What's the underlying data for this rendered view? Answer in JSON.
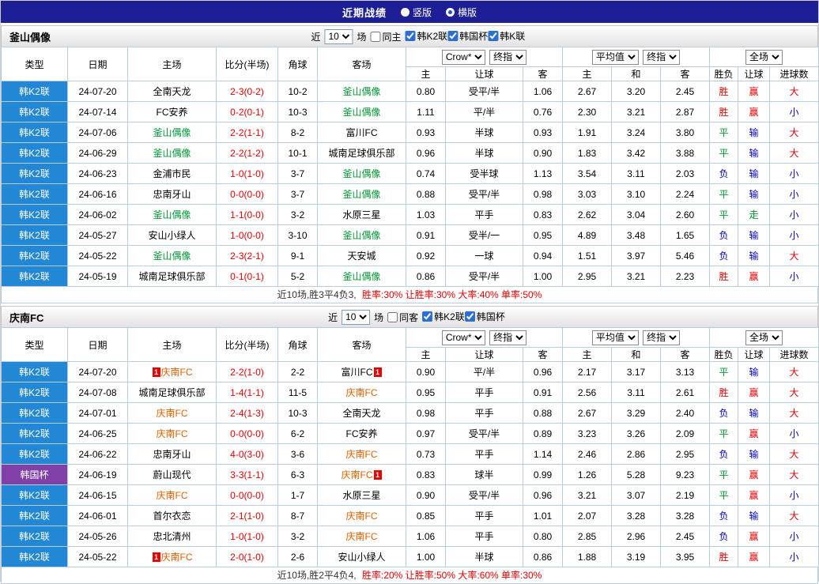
{
  "topbar": {
    "title": "近期战绩",
    "options": [
      {
        "label": "竖版",
        "selected": false
      },
      {
        "label": "横版",
        "selected": true
      }
    ]
  },
  "labels": {
    "near": "近",
    "games": "场",
    "col_type": "类型",
    "col_date": "日期",
    "col_home": "主场",
    "col_score": "比分(半场)",
    "col_corner": "角球",
    "col_away": "客场",
    "crow": "Crow*",
    "final": "终指",
    "average": "平均值",
    "full": "全场",
    "sub_home": "主",
    "sub_handicap": "让球",
    "sub_away": "客",
    "sub_avg_home": "主",
    "sub_avg_draw": "和",
    "sub_avg_away": "客",
    "sub_result": "胜负",
    "sub_handicap2": "让球",
    "sub_goals": "进球数"
  },
  "colors": {
    "topbar_navy": "#1e1e96",
    "league_blue": "#2287d5",
    "cup_purple": "#8040a8",
    "score_red": "#e60000",
    "team_green": "#009933",
    "team_orange": "#e06000",
    "lose_blue": "#0000cc"
  },
  "sections": [
    {
      "team": "釜山偶像",
      "filters": {
        "count": "10",
        "same_label": "同主",
        "same_checked": false,
        "leagues": [
          {
            "label": "韩K2联",
            "checked": true
          },
          {
            "label": "韩国杯",
            "checked": true
          },
          {
            "label": "韩K联",
            "checked": true
          }
        ]
      },
      "rows": [
        {
          "type": "韩K2联",
          "tc": "k2",
          "date": "24-07-20",
          "home": {
            "n": "全南天龙",
            "c": "",
            "b": 0
          },
          "score": "2-3(0-2)",
          "corner": "10-2",
          "away": {
            "n": "釜山偶像",
            "c": "g",
            "b": 0
          },
          "odds": [
            "0.80",
            "受平/半",
            "1.06",
            "2.67",
            "3.20",
            "2.45"
          ],
          "results": [
            "胜",
            "赢",
            "大"
          ]
        },
        {
          "type": "韩K2联",
          "tc": "k2",
          "date": "24-07-14",
          "home": {
            "n": "FC安养",
            "c": "",
            "b": 0
          },
          "score": "0-2(0-1)",
          "corner": "10-3",
          "away": {
            "n": "釜山偶像",
            "c": "g",
            "b": 0
          },
          "odds": [
            "1.11",
            "平/半",
            "0.76",
            "2.30",
            "3.21",
            "2.87"
          ],
          "results": [
            "胜",
            "赢",
            "小"
          ]
        },
        {
          "type": "韩K2联",
          "tc": "k2",
          "date": "24-07-06",
          "home": {
            "n": "釜山偶像",
            "c": "g",
            "b": 0
          },
          "score": "2-2(1-1)",
          "corner": "8-2",
          "away": {
            "n": "富川FC",
            "c": "",
            "b": 0
          },
          "odds": [
            "0.93",
            "半球",
            "0.93",
            "1.91",
            "3.24",
            "3.80"
          ],
          "results": [
            "平",
            "输",
            "大"
          ]
        },
        {
          "type": "韩K2联",
          "tc": "k2",
          "date": "24-06-29",
          "home": {
            "n": "釜山偶像",
            "c": "g",
            "b": 0
          },
          "score": "2-2(1-2)",
          "corner": "10-1",
          "away": {
            "n": "城南足球俱乐部",
            "c": "",
            "b": 0
          },
          "odds": [
            "0.96",
            "半球",
            "0.90",
            "1.83",
            "3.42",
            "3.88"
          ],
          "results": [
            "平",
            "输",
            "大"
          ]
        },
        {
          "type": "韩K2联",
          "tc": "k2",
          "date": "24-06-23",
          "home": {
            "n": "金浦市民",
            "c": "",
            "b": 0
          },
          "score": "1-0(1-0)",
          "corner": "3-7",
          "away": {
            "n": "釜山偶像",
            "c": "g",
            "b": 0
          },
          "odds": [
            "0.74",
            "受半球",
            "1.13",
            "3.54",
            "3.11",
            "2.03"
          ],
          "results": [
            "负",
            "输",
            "小"
          ]
        },
        {
          "type": "韩K2联",
          "tc": "k2",
          "date": "24-06-16",
          "home": {
            "n": "忠南牙山",
            "c": "",
            "b": 0
          },
          "score": "0-0(0-0)",
          "corner": "3-7",
          "away": {
            "n": "釜山偶像",
            "c": "g",
            "b": 0
          },
          "odds": [
            "0.88",
            "受平/半",
            "0.98",
            "3.03",
            "3.10",
            "2.24"
          ],
          "results": [
            "平",
            "输",
            "小"
          ]
        },
        {
          "type": "韩K2联",
          "tc": "k2",
          "date": "24-06-02",
          "home": {
            "n": "釜山偶像",
            "c": "g",
            "b": 0
          },
          "score": "1-1(0-0)",
          "corner": "3-2",
          "away": {
            "n": "水原三星",
            "c": "",
            "b": 0
          },
          "odds": [
            "1.03",
            "平手",
            "0.83",
            "2.62",
            "3.04",
            "2.60"
          ],
          "results": [
            "平",
            "走",
            "小"
          ]
        },
        {
          "type": "韩K2联",
          "tc": "k2",
          "date": "24-05-27",
          "home": {
            "n": "安山小绿人",
            "c": "",
            "b": 0
          },
          "score": "1-0(0-0)",
          "corner": "3-10",
          "away": {
            "n": "釜山偶像",
            "c": "g",
            "b": 0
          },
          "odds": [
            "0.91",
            "受半/一",
            "0.95",
            "4.89",
            "3.48",
            "1.65"
          ],
          "results": [
            "负",
            "输",
            "小"
          ]
        },
        {
          "type": "韩K2联",
          "tc": "k2",
          "date": "24-05-22",
          "home": {
            "n": "釜山偶像",
            "c": "g",
            "b": 0
          },
          "score": "2-3(2-1)",
          "corner": "9-1",
          "away": {
            "n": "天安城",
            "c": "",
            "b": 0
          },
          "odds": [
            "0.92",
            "一球",
            "0.94",
            "1.51",
            "3.97",
            "5.46"
          ],
          "results": [
            "负",
            "输",
            "大"
          ]
        },
        {
          "type": "韩K2联",
          "tc": "k2",
          "date": "24-05-19",
          "home": {
            "n": "城南足球俱乐部",
            "c": "",
            "b": 0
          },
          "score": "0-1(0-1)",
          "corner": "5-2",
          "away": {
            "n": "釜山偶像",
            "c": "g",
            "b": 0
          },
          "odds": [
            "0.86",
            "受平/半",
            "1.00",
            "2.95",
            "3.21",
            "2.23"
          ],
          "results": [
            "胜",
            "赢",
            "小"
          ]
        }
      ],
      "footer": {
        "summary": "近10场,胜3平4负3,",
        "stats": "胜率:30% 让胜率:30% 大率:40% 单率:50%"
      }
    },
    {
      "team": "庆南FC",
      "filters": {
        "count": "10",
        "same_label": "同客",
        "same_checked": false,
        "leagues": [
          {
            "label": "韩K2联",
            "checked": true
          },
          {
            "label": "韩国杯",
            "checked": true
          }
        ]
      },
      "rows": [
        {
          "type": "韩K2联",
          "tc": "k2",
          "date": "24-07-20",
          "home": {
            "n": "庆南FC",
            "c": "o",
            "b": 1
          },
          "score": "2-2(1-0)",
          "corner": "2-2",
          "away": {
            "n": "富川FC",
            "c": "",
            "b": 2
          },
          "odds": [
            "0.90",
            "平/半",
            "0.96",
            "2.17",
            "3.17",
            "3.13"
          ],
          "results": [
            "平",
            "输",
            "大"
          ]
        },
        {
          "type": "韩K2联",
          "tc": "k2",
          "date": "24-07-08",
          "home": {
            "n": "城南足球俱乐部",
            "c": "",
            "b": 0
          },
          "score": "1-4(1-1)",
          "corner": "11-5",
          "away": {
            "n": "庆南FC",
            "c": "o",
            "b": 0
          },
          "odds": [
            "0.95",
            "平手",
            "0.91",
            "2.56",
            "3.11",
            "2.61"
          ],
          "results": [
            "胜",
            "赢",
            "大"
          ]
        },
        {
          "type": "韩K2联",
          "tc": "k2",
          "date": "24-07-01",
          "home": {
            "n": "庆南FC",
            "c": "o",
            "b": 0
          },
          "score": "2-4(1-3)",
          "corner": "10-3",
          "away": {
            "n": "全南天龙",
            "c": "",
            "b": 0
          },
          "odds": [
            "0.98",
            "平手",
            "0.88",
            "2.67",
            "3.29",
            "2.40"
          ],
          "results": [
            "负",
            "输",
            "大"
          ]
        },
        {
          "type": "韩K2联",
          "tc": "k2",
          "date": "24-06-25",
          "home": {
            "n": "庆南FC",
            "c": "o",
            "b": 0
          },
          "score": "0-0(0-0)",
          "corner": "6-2",
          "away": {
            "n": "FC安养",
            "c": "",
            "b": 0
          },
          "odds": [
            "0.97",
            "受平/半",
            "0.89",
            "3.23",
            "3.26",
            "2.09"
          ],
          "results": [
            "平",
            "赢",
            "小"
          ]
        },
        {
          "type": "韩K2联",
          "tc": "k2",
          "date": "24-06-22",
          "home": {
            "n": "忠南牙山",
            "c": "",
            "b": 0
          },
          "score": "4-0(3-0)",
          "corner": "3-6",
          "away": {
            "n": "庆南FC",
            "c": "o",
            "b": 0
          },
          "odds": [
            "0.73",
            "平手",
            "1.14",
            "2.46",
            "2.86",
            "2.95"
          ],
          "results": [
            "负",
            "输",
            "大"
          ]
        },
        {
          "type": "韩国杯",
          "tc": "cup",
          "date": "24-06-19",
          "home": {
            "n": "蔚山现代",
            "c": "",
            "b": 0
          },
          "score": "3-3(1-1)",
          "corner": "6-3",
          "away": {
            "n": "庆南FC",
            "c": "o",
            "b": 2
          },
          "odds": [
            "0.83",
            "球半",
            "0.99",
            "1.26",
            "5.28",
            "9.23"
          ],
          "results": [
            "平",
            "赢",
            "大"
          ]
        },
        {
          "type": "韩K2联",
          "tc": "k2",
          "date": "24-06-15",
          "home": {
            "n": "庆南FC",
            "c": "o",
            "b": 0
          },
          "score": "0-0(0-0)",
          "corner": "1-7",
          "away": {
            "n": "水原三星",
            "c": "",
            "b": 0
          },
          "odds": [
            "0.90",
            "受平/半",
            "0.96",
            "3.21",
            "3.07",
            "2.19"
          ],
          "results": [
            "平",
            "赢",
            "小"
          ]
        },
        {
          "type": "韩K2联",
          "tc": "k2",
          "date": "24-06-01",
          "home": {
            "n": "首尔衣恋",
            "c": "",
            "b": 0
          },
          "score": "2-1(1-0)",
          "corner": "8-7",
          "away": {
            "n": "庆南FC",
            "c": "o",
            "b": 0
          },
          "odds": [
            "0.85",
            "平手",
            "1.01",
            "2.07",
            "3.28",
            "3.28"
          ],
          "results": [
            "负",
            "输",
            "大"
          ]
        },
        {
          "type": "韩K2联",
          "tc": "k2",
          "date": "24-05-26",
          "home": {
            "n": "忠北清州",
            "c": "",
            "b": 0
          },
          "score": "1-0(1-0)",
          "corner": "3-2",
          "away": {
            "n": "庆南FC",
            "c": "o",
            "b": 0
          },
          "odds": [
            "1.06",
            "平手",
            "0.80",
            "2.85",
            "2.96",
            "2.45"
          ],
          "results": [
            "负",
            "赢",
            "小"
          ]
        },
        {
          "type": "韩K2联",
          "tc": "k2",
          "date": "24-05-22",
          "home": {
            "n": "庆南FC",
            "c": "o",
            "b": 1
          },
          "score": "2-0(1-0)",
          "corner": "2-6",
          "away": {
            "n": "安山小绿人",
            "c": "",
            "b": 0
          },
          "odds": [
            "1.00",
            "半球",
            "0.86",
            "1.88",
            "3.19",
            "3.95"
          ],
          "results": [
            "胜",
            "赢",
            "小"
          ]
        }
      ],
      "footer": {
        "summary": "近10场,胜2平4负4,",
        "stats": "胜率:20% 让胜率:50% 大率:60% 单率:30%"
      }
    }
  ]
}
